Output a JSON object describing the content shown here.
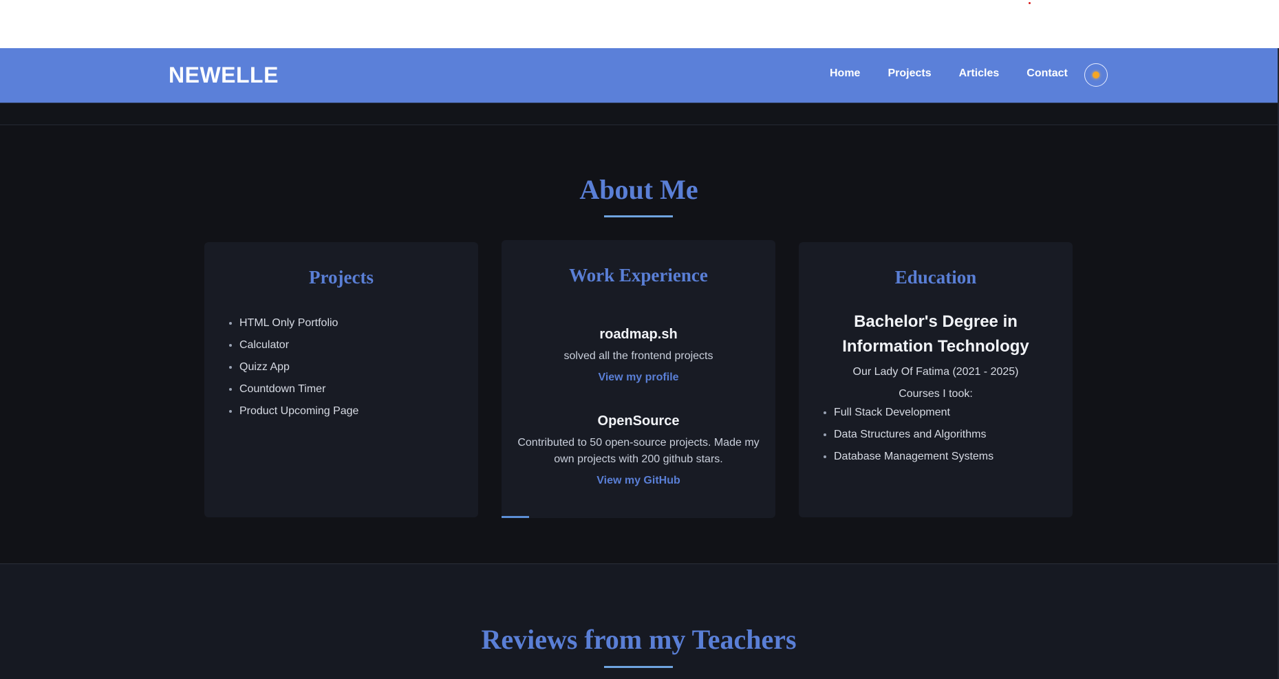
{
  "navbar": {
    "brand": "NEWELLE",
    "links": [
      "Home",
      "Projects",
      "Articles",
      "Contact"
    ],
    "theme_toggle_icon": "sun-icon"
  },
  "about": {
    "title": "About Me",
    "projects": {
      "title": "Projects",
      "items": [
        "HTML Only Portfolio",
        "Calculator",
        "Quizz App",
        "Countdown Timer",
        "Product Upcoming Page"
      ]
    },
    "work": {
      "title": "Work Experience",
      "entries": [
        {
          "name": "roadmap.sh",
          "desc": "solved all the frontend projects",
          "link": "View my profile"
        },
        {
          "name": "OpenSource",
          "desc": "Contributed to 50 open-source projects. Made my own projects with 200 github stars.",
          "link": "View my GitHub"
        }
      ]
    },
    "education": {
      "title": "Education",
      "degree": "Bachelor's Degree in Information Technology",
      "school": "Our Lady Of Fatima (2021 - 2025)",
      "courses_label": "Courses I took:",
      "courses": [
        "Full Stack Development",
        "Data Structures and Algorithms",
        "Database Management Systems"
      ]
    }
  },
  "reviews": {
    "title": "Reviews from my Teachers"
  },
  "colors": {
    "navbar_bg": "#5b80d9",
    "page_bg": "#111217",
    "card_bg": "#181b24",
    "accent": "#5a7fd6",
    "underline": "#6fa4e0"
  }
}
